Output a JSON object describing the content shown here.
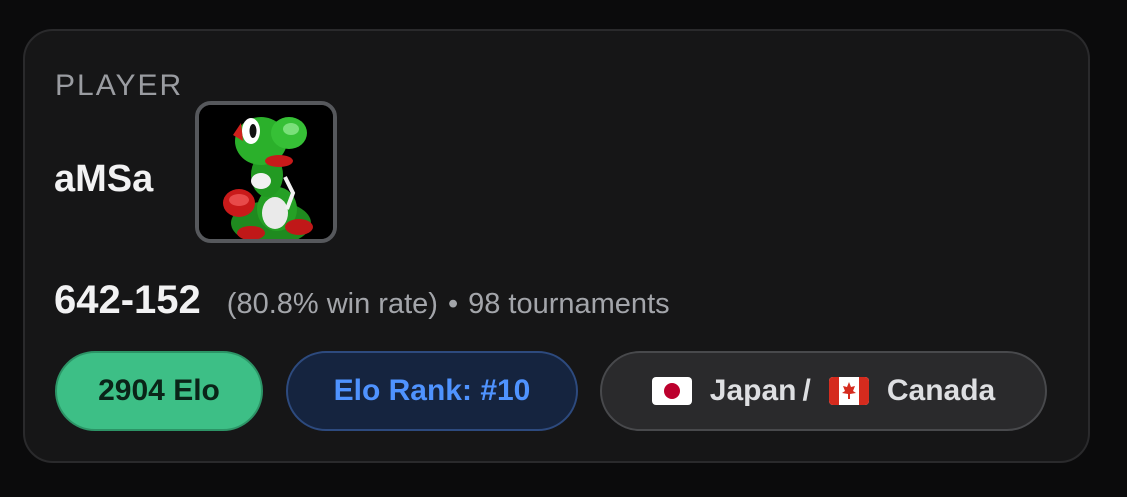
{
  "card": {
    "section_label": "PLAYER",
    "player_name": "aMSa",
    "avatar_icon": "yoshi-character-icon",
    "record": "642-152",
    "win_rate": "(80.8% win rate)",
    "separator": "•",
    "tournaments": "98 tournaments",
    "badges": {
      "elo": "2904 Elo",
      "rank": "Elo Rank: #10",
      "country_1": "Japan",
      "country_separator": "/",
      "country_2": "Canada",
      "flag_1_icon": "japan-flag-icon",
      "flag_2_icon": "canada-flag-icon"
    }
  },
  "colors": {
    "card_background": "#161617",
    "elo_badge": "#3dbf86",
    "rank_badge_text": "#4f93ff",
    "country_badge": "#2a2a2c"
  }
}
